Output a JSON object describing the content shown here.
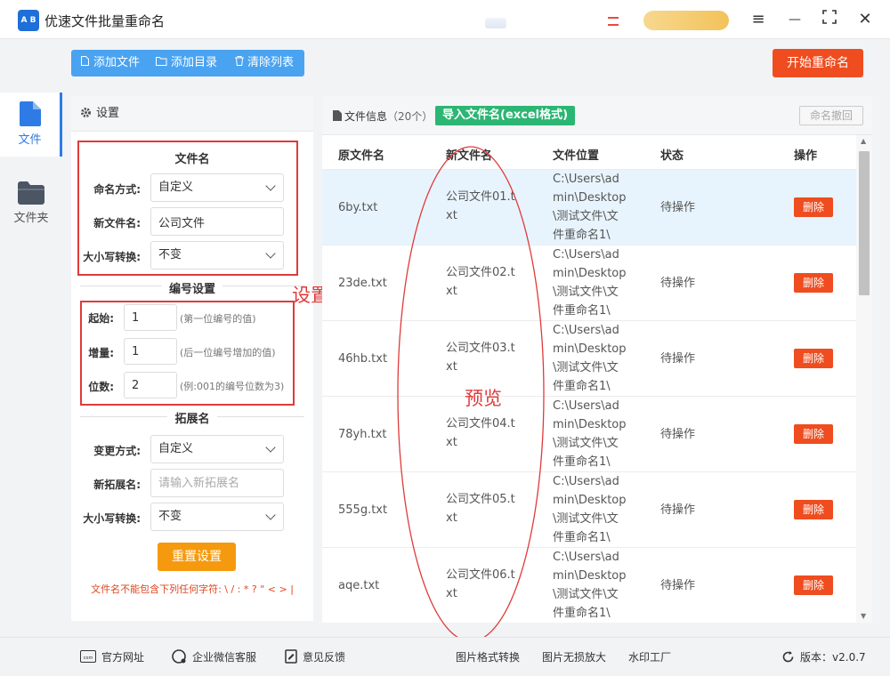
{
  "app": {
    "logo_text": "A B",
    "title": "优速文件批量重命名"
  },
  "window_controls": {
    "menu": "≡",
    "minimize": "—",
    "maximize": "⛶",
    "close": "✕"
  },
  "nav": {
    "items": [
      {
        "label": "文件",
        "icon": "file-icon",
        "active": true
      },
      {
        "label": "文件夹",
        "icon": "folder-icon",
        "active": false
      }
    ]
  },
  "toolbar": {
    "add_file": "添加文件",
    "add_dir": "添加目录",
    "clear_list": "清除列表",
    "start_rename": "开始重命名"
  },
  "settings": {
    "header": "设置",
    "filename_section": "文件名",
    "naming_label": "命名方式:",
    "naming_value": "自定义",
    "new_name_label": "新文件名:",
    "new_name_value": "公司文件",
    "case_label": "大小写转换:",
    "case_value": "不变",
    "numbering_section": "编号设置",
    "start_label": "起始:",
    "start_value": "1",
    "start_hint": "(第一位编号的值)",
    "step_label": "增量:",
    "step_value": "1",
    "step_hint": "(后一位编号增加的值)",
    "digits_label": "位数:",
    "digits_value": "2",
    "digits_hint": "(例:001的编号位数为3)",
    "ext_section": "拓展名",
    "ext_mode_label": "变更方式:",
    "ext_mode_value": "自定义",
    "new_ext_label": "新拓展名:",
    "new_ext_placeholder": "请输入新拓展名",
    "ext_case_label": "大小写转换:",
    "ext_case_value": "不变",
    "reset_button": "重置设置",
    "warning": "文件名不能包含下列任何字符: \\ / : * ? \" < > |"
  },
  "annotations": {
    "settings_note": "设置",
    "preview_note": "预览"
  },
  "file_panel": {
    "title": "文件信息",
    "count": "（20个）",
    "import_button": "导入文件名(excel格式)",
    "undo_button": "命名撤回",
    "columns": [
      "原文件名",
      "新文件名",
      "文件位置",
      "状态",
      "操作"
    ],
    "rows": [
      {
        "original": "6by.txt",
        "new": "公司文件01.txt",
        "location": "C:\\Users\\admin\\Desktop\\测试文件\\文件重命名1\\",
        "status": "待操作",
        "action": "删除"
      },
      {
        "original": "23de.txt",
        "new": "公司文件02.txt",
        "location": "C:\\Users\\admin\\Desktop\\测试文件\\文件重命名1\\",
        "status": "待操作",
        "action": "删除"
      },
      {
        "original": "46hb.txt",
        "new": "公司文件03.txt",
        "location": "C:\\Users\\admin\\Desktop\\测试文件\\文件重命名1\\",
        "status": "待操作",
        "action": "删除"
      },
      {
        "original": "78yh.txt",
        "new": "公司文件04.txt",
        "location": "C:\\Users\\admin\\Desktop\\测试文件\\文件重命名1\\",
        "status": "待操作",
        "action": "删除"
      },
      {
        "original": "555g.txt",
        "new": "公司文件05.txt",
        "location": "C:\\Users\\admin\\Desktop\\测试文件\\文件重命名1\\",
        "status": "待操作",
        "action": "删除"
      },
      {
        "original": "aqe.txt",
        "new": "公司文件06.txt",
        "location": "C:\\Users\\admin\\Desktop\\测试文件\\文件重命名1\\",
        "status": "待操作",
        "action": "删除"
      }
    ]
  },
  "footer": {
    "website": "官方网址",
    "wechat": "企业微信客服",
    "feedback": "意见反馈",
    "img_convert": "图片格式转换",
    "img_enlarge": "图片无损放大",
    "watermark": "水印工厂",
    "version_label": "版本：",
    "version": "v2.0.7"
  },
  "colors": {
    "accent_blue": "#4aa3f0",
    "start_orange": "#ef4d1f",
    "import_green": "#2bb673",
    "reset_orange": "#f59a0e",
    "annotation_red": "#e03a3a"
  }
}
